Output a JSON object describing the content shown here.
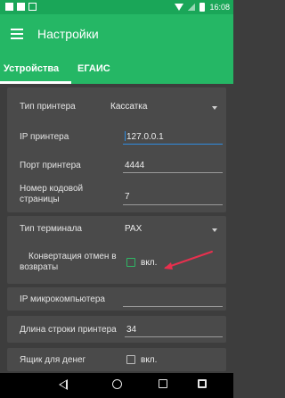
{
  "statusbar": {
    "time": "16:08"
  },
  "appbar": {
    "title": "Настройки"
  },
  "tabs": [
    {
      "label": "Устройства",
      "active": true
    },
    {
      "label": "ЕГАИС",
      "active": false
    }
  ],
  "settings": {
    "printer_type": {
      "label": "Тип принтера",
      "value": "Кассатка"
    },
    "printer_ip": {
      "label": "IP принтера",
      "value": "127.0.0.1"
    },
    "printer_port": {
      "label": "Порт принтера",
      "value": "4444"
    },
    "codepage": {
      "label_line1": "Номер кодовой",
      "label_line2": "страницы",
      "value": "7"
    },
    "terminal_type": {
      "label": "Тип терминала",
      "value": "PAX"
    },
    "convert_returns": {
      "label_line1": "Конвертация отмен в",
      "label_line2": "возвраты",
      "checkbox_label": "вкл.",
      "checked": false
    },
    "micro_ip": {
      "label": "IP микрокомпьютера",
      "value": ""
    },
    "printer_line_length": {
      "label": "Длина строки принтера",
      "value": "34"
    },
    "cash_drawer": {
      "label": "Ящик для денег",
      "checkbox_label": "вкл.",
      "checked": false
    }
  },
  "colors": {
    "accent": "#25b765",
    "annotation_arrow": "#e8304e",
    "focus_underline": "#2f8ce0"
  }
}
